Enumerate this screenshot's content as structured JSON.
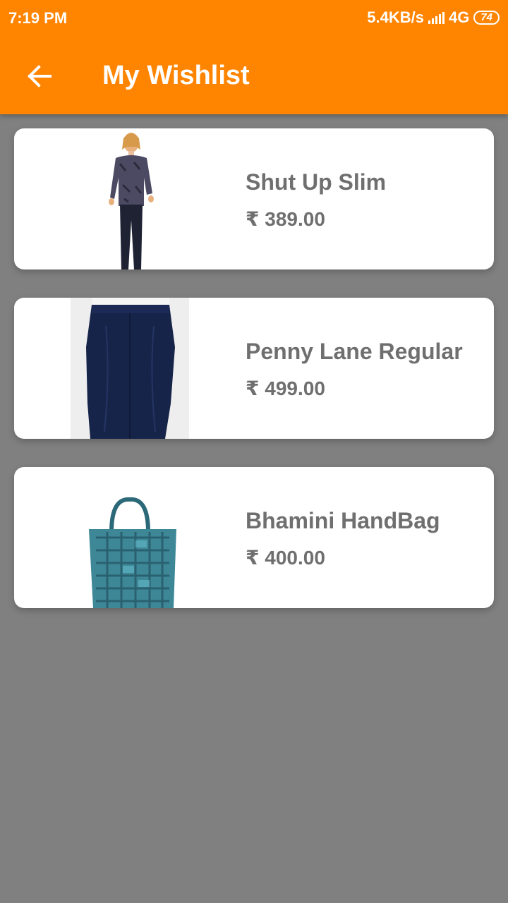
{
  "status": {
    "time": "7:19 PM",
    "speed": "5.4KB/s",
    "network": "4G",
    "battery": "74"
  },
  "header": {
    "title": "My Wishlist",
    "background_color": "#ff8400"
  },
  "items": [
    {
      "name": "Shut Up Slim",
      "price": "₹ 389.00",
      "image": "woman-jeans-top-photo"
    },
    {
      "name": "Penny Lane Regular",
      "price": "₹ 499.00",
      "image": "navy-pencil-skirt-photo"
    },
    {
      "name": "Bhamini HandBag",
      "price": "₹ 400.00",
      "image": "teal-woven-handbag-photo"
    }
  ]
}
